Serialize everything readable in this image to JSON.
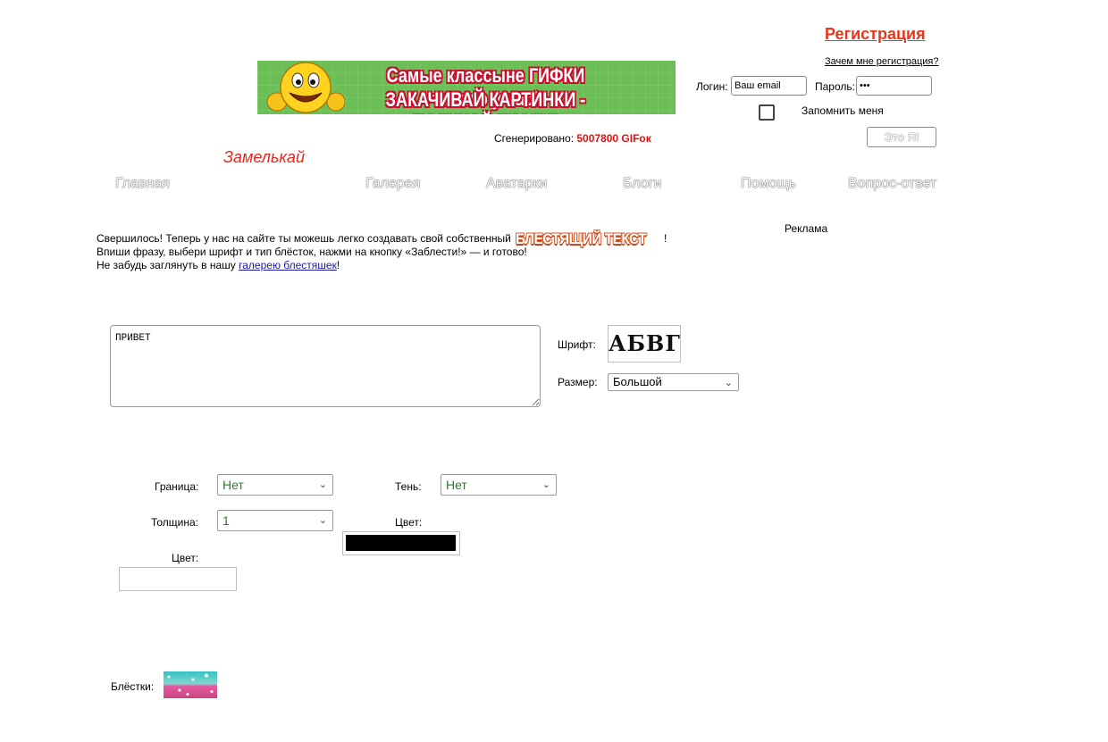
{
  "header": {
    "register_link": "Регистрация",
    "why_register_link": "Зачем мне регистрация?",
    "login_label": "Логин:",
    "login_value": "Ваш email",
    "password_label": "Пароль:",
    "password_value": "•••",
    "remember_label": "Запомнить меня",
    "submit_label": "Это Я!"
  },
  "banner": {
    "line1": "Самые классыне ГИФКИ только у нас!",
    "line2": "ЗАКАЧИВАЙ КАРТИНКИ - ПОЛУЧАЙ ГИФКИ!"
  },
  "generated": {
    "label": "Сгенерировано:",
    "count": "5007800 GIFок"
  },
  "brand": "Замелькай",
  "nav": [
    "Главная",
    "Галерея",
    "Аватарки",
    "Блоги",
    "Помощь",
    "Вопрос-ответ"
  ],
  "ad_label": "Реклама",
  "intro": {
    "line1": "Свершилось! Теперь у нас на сайте ты можешь легко создавать свой собственный",
    "glitter_word": "БЛЕСТЯЩИЙ ТЕКСТ",
    "line1_end": "!",
    "line2": "Впиши фразу, выбери шрифт и тип блёсток, нажми на кнопку «Заблести!» — и готово!",
    "line3_start": "Не забудь заглянуть в нашу",
    "gallery_link": "галерею блестяшек",
    "line3_end": "!"
  },
  "form": {
    "phrase_value": "ПРИВЕТ",
    "font_label": "Шрифт:",
    "font_preview": "АБВГ",
    "size_label": "Размер:",
    "size_value": "Большой",
    "border_label": "Граница:",
    "border_value": "Нет",
    "shadow_label": "Тень:",
    "shadow_value": "Нет",
    "thickness_label": "Толщина:",
    "thickness_value": "1",
    "color_label_right": "Цвет:",
    "color_label_left": "Цвет:",
    "sparkles_label": "Блёстки:"
  },
  "colors": {
    "accent": "#e8361c",
    "link": "#1a1aa6",
    "counter": "#e01010",
    "select_value": "#2a7b2a",
    "chosen_shadow_color": "#000000"
  }
}
